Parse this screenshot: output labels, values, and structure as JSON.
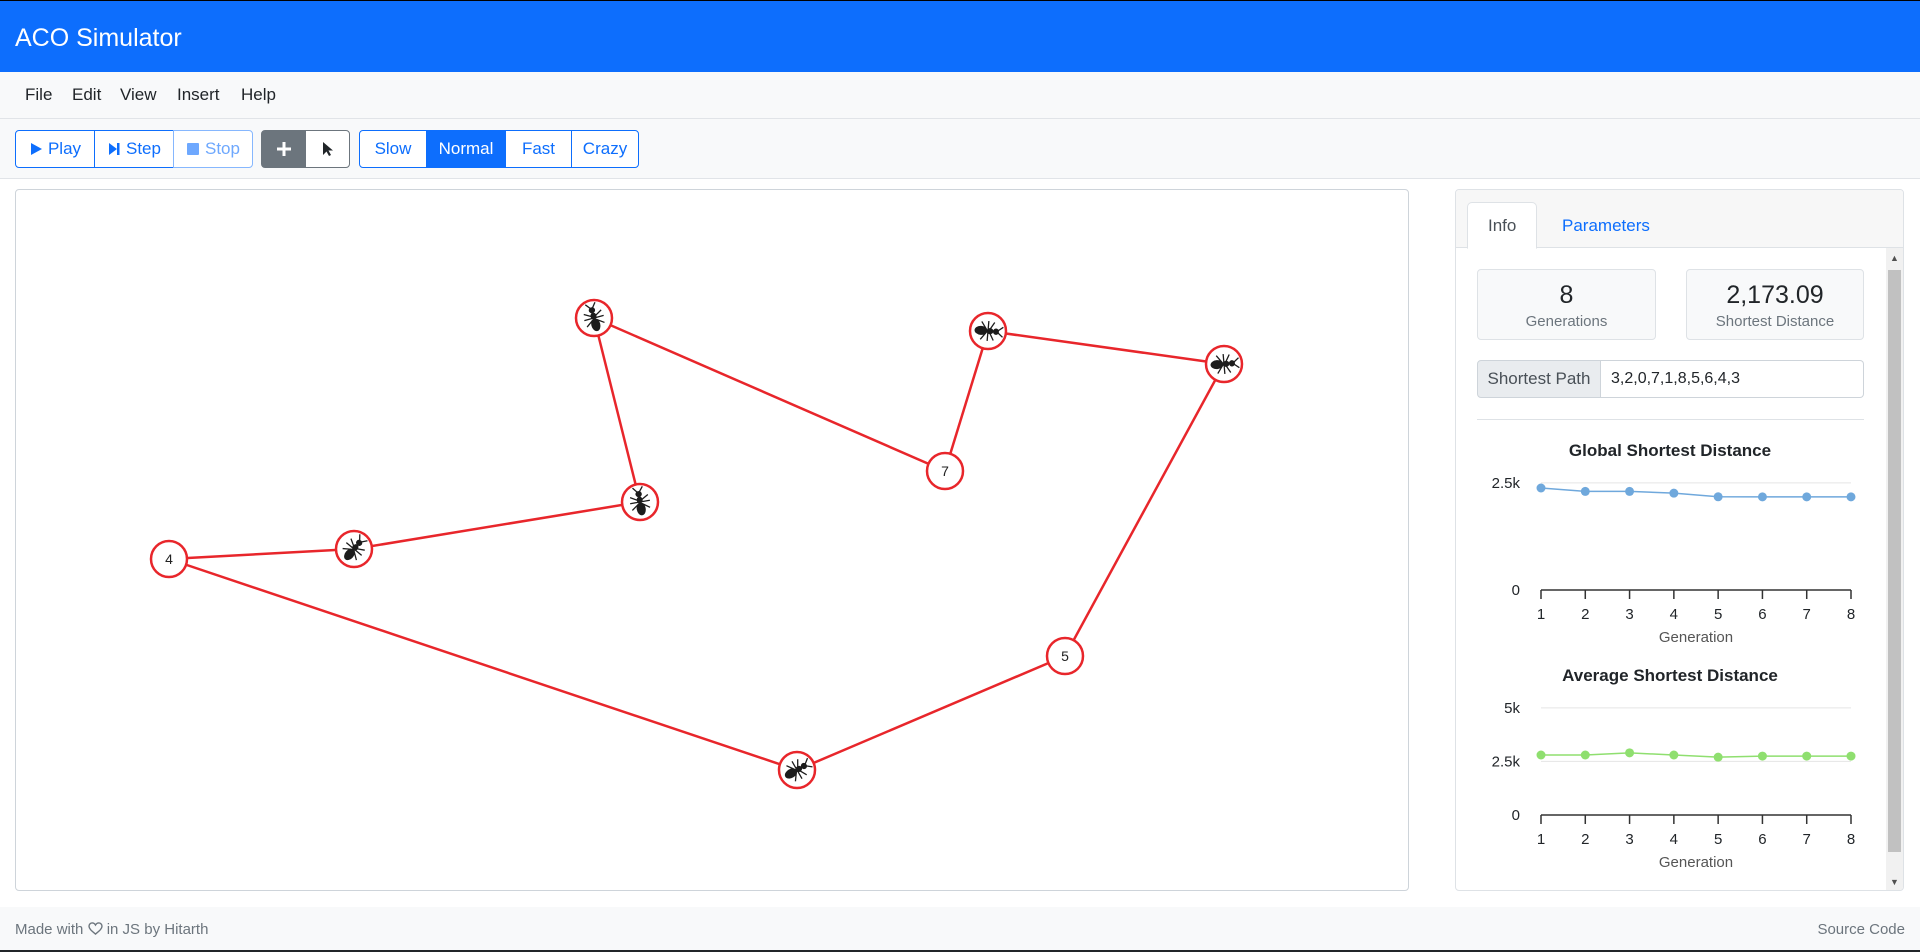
{
  "app": {
    "title": "ACO Simulator"
  },
  "menu": {
    "items": [
      "File",
      "Edit",
      "View",
      "Insert",
      "Help"
    ]
  },
  "toolbar": {
    "play_label": "Play",
    "step_label": "Step",
    "stop_label": "Stop",
    "add_icon": "plus-icon",
    "select_icon": "cursor-icon",
    "speeds": [
      "Slow",
      "Normal",
      "Fast",
      "Crazy"
    ],
    "active_speed": "Normal"
  },
  "graph": {
    "edge_color": "#e8262b",
    "visible_node_labels": [
      "4",
      "7",
      "5"
    ]
  },
  "info": {
    "tabs": [
      "Info",
      "Parameters"
    ],
    "active_tab": "Info",
    "generations_value": "8",
    "generations_label": "Generations",
    "shortest_distance_value": "2,173.09",
    "shortest_distance_label": "Shortest Distance",
    "shortest_path_label": "Shortest Path",
    "shortest_path_value": "3,2,0,7,1,8,5,6,4,3"
  },
  "chart_data": [
    {
      "type": "line",
      "title": "Global Shortest Distance",
      "xlabel": "Generation",
      "ylabel": "",
      "x": [
        1,
        2,
        3,
        4,
        5,
        6,
        7,
        8
      ],
      "series": [
        {
          "values": [
            2380,
            2300,
            2300,
            2260,
            2175,
            2173,
            2173,
            2173
          ],
          "color": "#6fa8dc"
        }
      ],
      "ylim": [
        0,
        2800
      ],
      "yticks": [
        {
          "value": 0,
          "label": "0"
        },
        {
          "value": 2500,
          "label": "2.5k"
        }
      ],
      "grid": true
    },
    {
      "type": "line",
      "title": "Average Shortest Distance",
      "xlabel": "Generation",
      "ylabel": "",
      "x": [
        1,
        2,
        3,
        4,
        5,
        6,
        7,
        8
      ],
      "series": [
        {
          "values": [
            2800,
            2800,
            2900,
            2800,
            2700,
            2750,
            2750,
            2750
          ],
          "color": "#8fdf6f"
        }
      ],
      "ylim": [
        0,
        5600
      ],
      "yticks": [
        {
          "value": 0,
          "label": "0"
        },
        {
          "value": 2500,
          "label": "2.5k"
        },
        {
          "value": 5000,
          "label": "5k"
        }
      ],
      "grid": true
    }
  ],
  "footer": {
    "made_with_prefix": "Made with",
    "made_with_suffix": "in JS by Hitarth",
    "source_code": "Source Code"
  }
}
